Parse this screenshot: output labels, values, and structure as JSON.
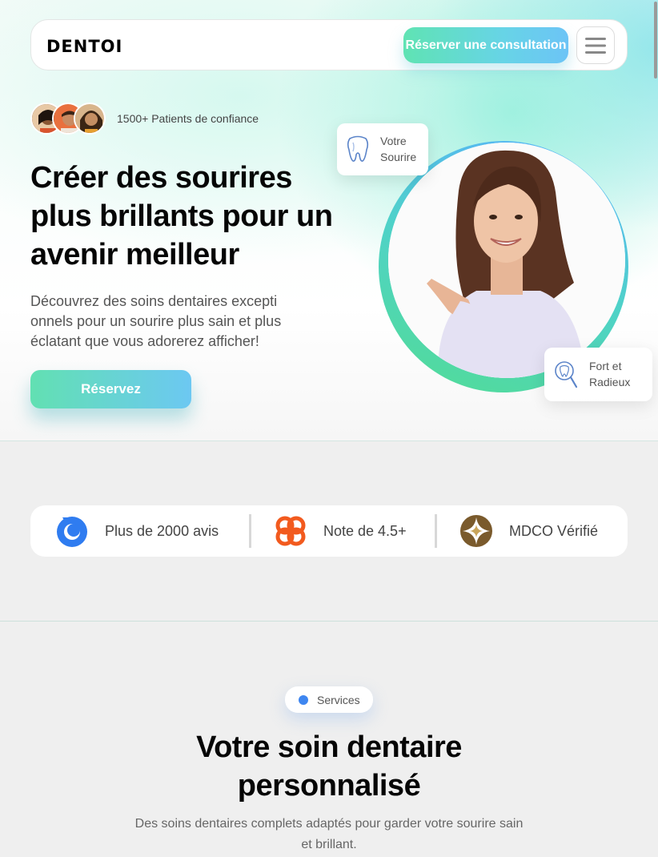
{
  "nav": {
    "logo": "DENTOI",
    "cta_label": "Réserver une consultation",
    "menu_icon": "hamburger-menu-icon"
  },
  "hero": {
    "patients_text": "1500+ Patients de confiance",
    "headline": "Créer des sourires plus brillants pour un avenir meilleur",
    "subtext": "Découvrez des soins dentaires excepti onnels pour un sourire plus sain et plus éclatant que vous adorerez afficher!",
    "cta_label": "Réservez",
    "card_smile": {
      "line1": "Votre",
      "line2": "Sourire",
      "icon": "tooth-icon"
    },
    "card_strong": {
      "line1": "Fort et",
      "line2": "Radieux",
      "icon": "tooth-magnifier-icon"
    }
  },
  "stats": {
    "items": [
      {
        "label": "Plus de 2000 avis",
        "icon": "blue-badge-icon",
        "color": "#2f7cf0"
      },
      {
        "label": "Note de 4.5+",
        "icon": "orange-flower-icon",
        "color": "#f25a1e"
      },
      {
        "label": "MDCO Vérifié",
        "icon": "compass-star-icon",
        "color": "#7a5a2c"
      }
    ]
  },
  "services": {
    "badge": "Services",
    "title": "Votre soin dentaire personnalisé",
    "subtitle": "Des soins dentaires complets adaptés pour garder votre sourire sain et brillant."
  },
  "colors": {
    "accent_green": "#5fe3b3",
    "accent_blue": "#6cc4f6",
    "badge_dot": "#3e86f0"
  }
}
